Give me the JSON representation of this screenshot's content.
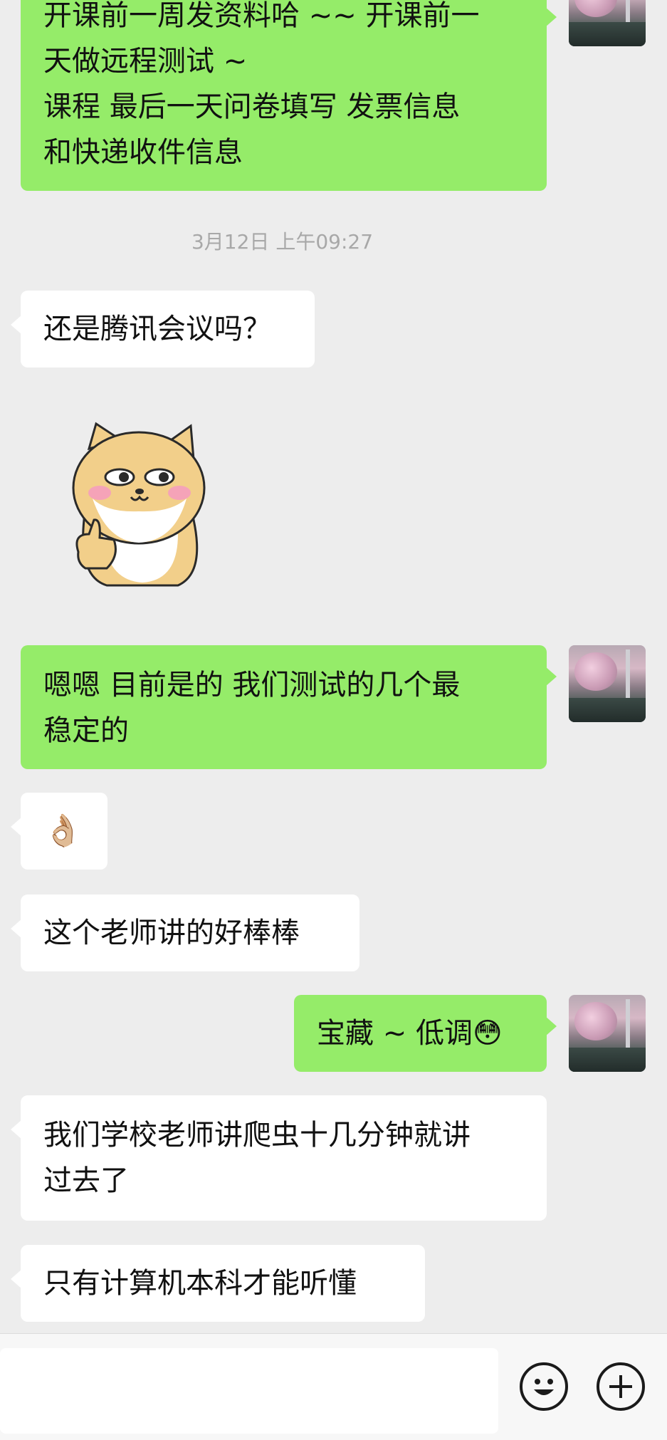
{
  "messages": [
    {
      "id": "m1",
      "side": "out",
      "lines": [
        "开课前一周发资料哈 ~~ 开课前一",
        "天做远程测试 ~",
        "课程 最后一天问卷填写 发票信息",
        "和快递收件信息"
      ]
    },
    {
      "id": "m2",
      "side": "in",
      "text": "还是腾讯会议吗？"
    },
    {
      "id": "m4",
      "side": "out",
      "lines": [
        "嗯嗯 目前是的  我们测试的几个最",
        "稳定的"
      ]
    },
    {
      "id": "m5",
      "side": "in",
      "text": "👌🏼"
    },
    {
      "id": "m6",
      "side": "in",
      "text": "这个老师讲的好棒棒"
    },
    {
      "id": "m7",
      "side": "out",
      "text": "宝藏 ~ 低调😳"
    },
    {
      "id": "m8",
      "side": "in",
      "lines": [
        "我们学校老师讲爬虫十几分钟就讲",
        "过去了"
      ]
    },
    {
      "id": "m9",
      "side": "in",
      "text": "只有计算机本科才能听懂"
    }
  ],
  "timestamp": "3月12日 上午09:27",
  "input": {
    "placeholder": ""
  }
}
